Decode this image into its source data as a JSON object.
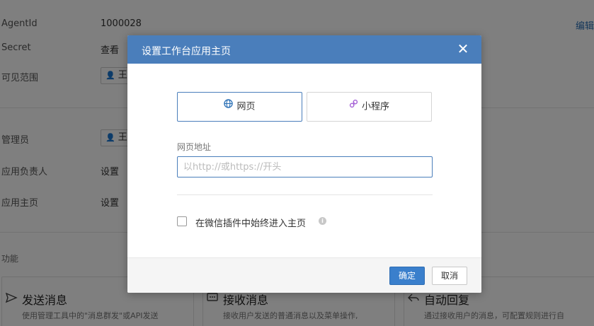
{
  "page": {
    "rows": [
      {
        "label": "AgentId",
        "value": "1000028"
      },
      {
        "label": "Secret",
        "value": "查看"
      },
      {
        "label": "可见范围",
        "chip": "王"
      },
      {
        "label": "管理员",
        "chip": "王"
      },
      {
        "label": "应用负责人",
        "value": "设置"
      },
      {
        "label": "应用主页",
        "value": "设置"
      }
    ],
    "edit_label": "编辑",
    "section_title": "功能",
    "cards": [
      {
        "title": "发送消息",
        "desc": "使用管理工具中的\"消息群发\"或API发送",
        "icon": "send-icon"
      },
      {
        "title": "接收消息",
        "desc": "接收用户发送的普通消息以及菜单操作,",
        "icon": "message-icon"
      },
      {
        "title": "自动回复",
        "desc": "通过接收用户的消息，可配置规则进行自",
        "icon": "reply-icon"
      }
    ]
  },
  "modal": {
    "title": "设置工作台应用主页",
    "close_symbol": "✕",
    "tabs": {
      "web": "网页",
      "mini_program": "小程序"
    },
    "url_label": "网页地址",
    "url_placeholder": "以http://或https://开头",
    "url_value": "",
    "checkbox_label": "在微信插件中始终进入主页",
    "checkbox_checked": false,
    "info_symbol": "i",
    "ok_label": "确定",
    "cancel_label": "取消"
  },
  "colors": {
    "header": "#4a7ebb",
    "primary_button": "#3a7fcc",
    "mini_program_icon": "#a45fd6",
    "web_icon": "#2a6fb5"
  }
}
